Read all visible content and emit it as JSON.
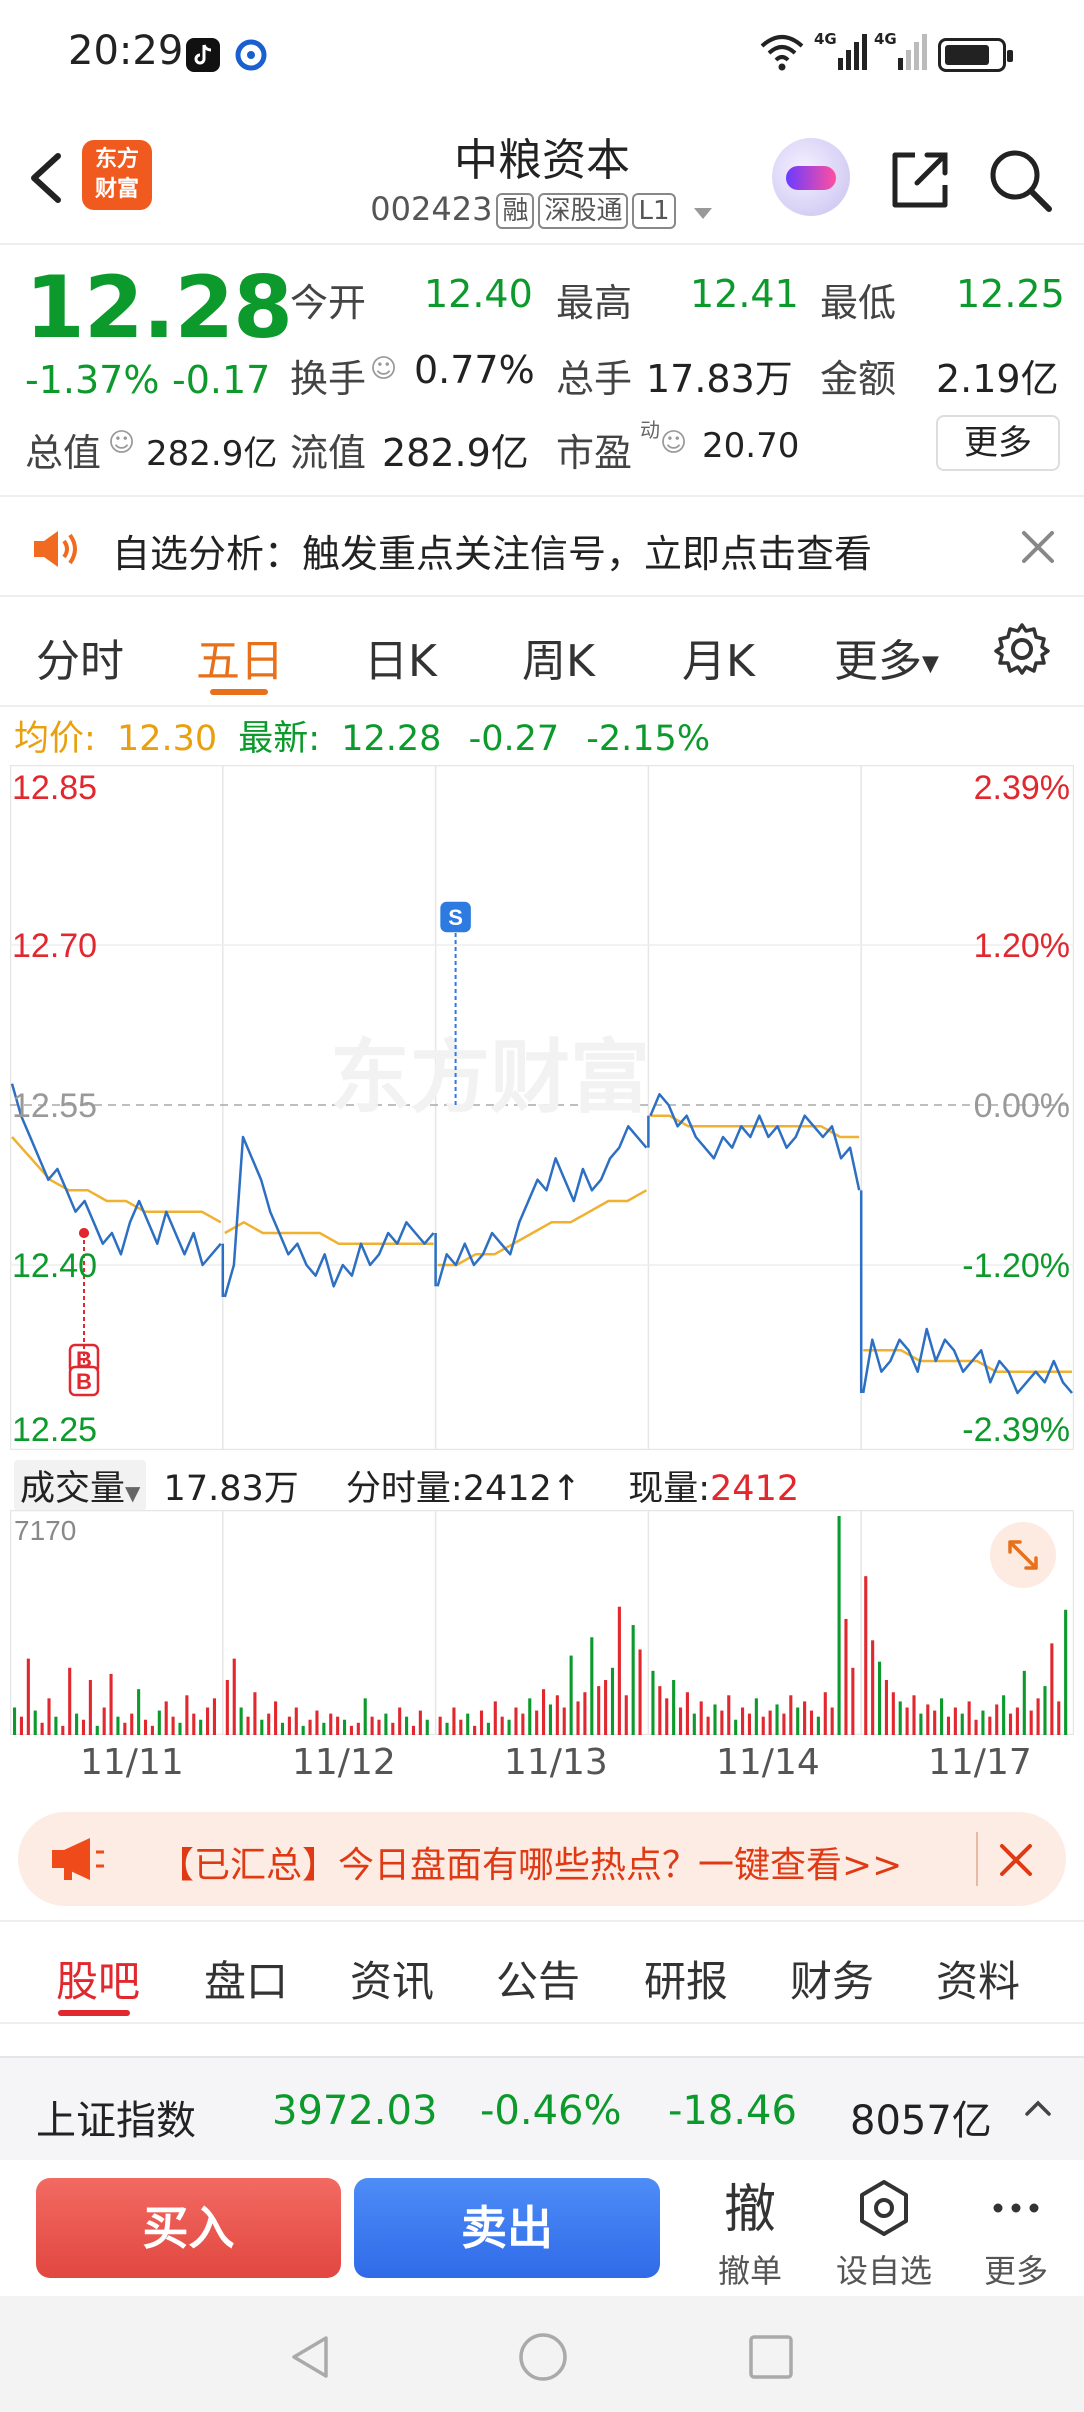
{
  "status_bar": {
    "time": "20:29",
    "network1": "4G",
    "network2": "4G"
  },
  "header": {
    "logo_line1": "东方",
    "logo_line2": "财富",
    "stock_name": "中粮资本",
    "stock_code": "002423",
    "tags": [
      "融",
      "深股通",
      "L1"
    ]
  },
  "quote": {
    "price": "12.28",
    "change_pct": "-1.37%",
    "change_abs": "-0.17",
    "open_label": "今开",
    "open": "12.40",
    "high_label": "最高",
    "high": "12.41",
    "low_label": "最低",
    "low": "12.25",
    "turnover_label": "换手",
    "turnover": "0.77%",
    "volume_label": "总手",
    "volume": "17.83万",
    "amount_label": "金额",
    "amount": "2.19亿",
    "mktcap_label": "总值",
    "mktcap": "282.9亿",
    "float_label": "流值",
    "float_cap": "282.9亿",
    "pe_label": "市盈",
    "pe_sup": "动",
    "pe": "20.70",
    "more": "更多"
  },
  "notice": {
    "text": "自选分析：触发重点关注信号，立即点击查看"
  },
  "tabs": [
    "分时",
    "五日",
    "日K",
    "周K",
    "月K",
    "更多"
  ],
  "chart_header": {
    "avg_label": "均价:",
    "avg": "12.30",
    "latest_label": "最新:",
    "latest": "12.28",
    "chg": "-0.27",
    "chg_pct": "-2.15%"
  },
  "chart_data": {
    "type": "line",
    "y_ticks_left": [
      "12.85",
      "12.70",
      "12.55",
      "12.40",
      "12.25"
    ],
    "y_ticks_right": [
      "2.39%",
      "1.20%",
      "0.00%",
      "-1.20%",
      "-2.39%"
    ],
    "ylim": [
      12.25,
      12.85
    ],
    "reference_price": 12.55,
    "x_labels": [
      "11/11",
      "11/12",
      "11/13",
      "11/14",
      "11/17"
    ],
    "watermark": "东方财富",
    "markers": [
      {
        "day": "11/11",
        "type": "B",
        "price": 12.43
      },
      {
        "day": "11/11",
        "type": "B",
        "price": 12.43
      },
      {
        "day": "11/13",
        "type": "S",
        "price": 12.55
      }
    ],
    "series": [
      {
        "name": "price",
        "days": [
          [
            12.57,
            12.54,
            12.52,
            12.5,
            12.48,
            12.49,
            12.47,
            12.45,
            12.46,
            12.44,
            12.42,
            12.43,
            12.41,
            12.44,
            12.46,
            12.44,
            12.42,
            12.45,
            12.43,
            12.41,
            12.43,
            12.4,
            12.41,
            12.42
          ],
          [
            12.37,
            12.4,
            12.52,
            12.5,
            12.48,
            12.45,
            12.43,
            12.41,
            12.42,
            12.4,
            12.39,
            12.41,
            12.38,
            12.4,
            12.39,
            12.42,
            12.4,
            12.41,
            12.43,
            12.42,
            12.44,
            12.43,
            12.42,
            12.43
          ],
          [
            12.38,
            12.41,
            12.4,
            12.42,
            12.4,
            12.41,
            12.43,
            12.42,
            12.41,
            12.44,
            12.46,
            12.48,
            12.47,
            12.5,
            12.48,
            12.46,
            12.49,
            12.47,
            12.48,
            12.5,
            12.51,
            12.53,
            12.52,
            12.51
          ],
          [
            12.54,
            12.56,
            12.55,
            12.53,
            12.54,
            12.52,
            12.51,
            12.5,
            12.52,
            12.51,
            12.53,
            12.52,
            12.54,
            12.52,
            12.53,
            12.51,
            12.52,
            12.54,
            12.53,
            12.52,
            12.53,
            12.5,
            12.51,
            12.47
          ],
          [
            12.28,
            12.33,
            12.3,
            12.31,
            12.33,
            12.32,
            12.3,
            12.34,
            12.31,
            12.33,
            12.32,
            12.3,
            12.31,
            12.32,
            12.29,
            12.31,
            12.3,
            12.28,
            12.29,
            12.3,
            12.29,
            12.31,
            12.29,
            12.28
          ]
        ]
      },
      {
        "name": "avg",
        "days": [
          [
            12.52,
            12.5,
            12.48,
            12.47,
            12.47,
            12.46,
            12.46,
            12.45,
            12.45,
            12.45,
            12.45,
            12.44
          ],
          [
            12.43,
            12.44,
            12.43,
            12.43,
            12.43,
            12.43,
            12.42,
            12.42,
            12.42,
            12.42,
            12.42,
            12.42
          ],
          [
            12.4,
            12.4,
            12.41,
            12.41,
            12.42,
            12.43,
            12.44,
            12.44,
            12.45,
            12.46,
            12.46,
            12.47
          ],
          [
            12.54,
            12.54,
            12.53,
            12.53,
            12.53,
            12.53,
            12.53,
            12.53,
            12.53,
            12.53,
            12.52,
            12.52
          ],
          [
            12.32,
            12.32,
            12.32,
            12.31,
            12.31,
            12.31,
            12.31,
            12.3,
            12.3,
            12.3,
            12.3,
            12.3
          ]
        ]
      }
    ],
    "volume_header": {
      "label": "成交量",
      "total": "17.83万",
      "tick_label": "分时量:",
      "tick_value": "2412",
      "now_label": "现量:",
      "now_value": "2412"
    },
    "volume_max_label": "7170",
    "volume": [
      [
        900,
        600,
        2500,
        800,
        400,
        1200,
        600,
        300,
        2200,
        700,
        500,
        1800,
        300,
        900,
        2000,
        600,
        400,
        700,
        1500,
        500,
        300,
        800,
        1100,
        600,
        400,
        1300,
        700,
        500,
        900,
        1200
      ],
      [
        1800,
        2500,
        900,
        600,
        1400,
        500,
        700,
        1100,
        400,
        600,
        900,
        300,
        500,
        800,
        400,
        700,
        600,
        500,
        300,
        400,
        1200,
        600,
        500,
        700,
        400,
        900,
        600,
        300,
        800,
        500
      ],
      [
        600,
        400,
        900,
        500,
        700,
        300,
        800,
        400,
        1100,
        600,
        500,
        900,
        700,
        1200,
        800,
        1500,
        1000,
        1300,
        900,
        2600,
        1100,
        1400,
        3200,
        1600,
        1800,
        2200,
        4200,
        1300,
        3600,
        2800
      ],
      [
        2100,
        1600,
        1200,
        1800,
        900,
        1400,
        700,
        1100,
        600,
        1000,
        800,
        1300,
        500,
        900,
        700,
        1200,
        600,
        800,
        1000,
        700,
        1300,
        900,
        1100,
        800,
        600,
        1400,
        900,
        7170,
        3800,
        2200
      ],
      [
        5200,
        3100,
        2400,
        1800,
        1400,
        1100,
        900,
        1300,
        700,
        1000,
        800,
        1200,
        600,
        900,
        700,
        1100,
        500,
        800,
        600,
        1000,
        1300,
        700,
        900,
        2100,
        800,
        1200,
        1600,
        3000,
        1100,
        4100
      ]
    ]
  },
  "banner": {
    "text": "【已汇总】今日盘面有哪些热点？一键查看>>"
  },
  "subtabs": [
    "股吧",
    "盘口",
    "资讯",
    "公告",
    "研报",
    "财务",
    "资料"
  ],
  "index_bar": {
    "name": "上证指数",
    "value": "3972.03",
    "pct": "-0.46%",
    "chg": "-18.46",
    "amount": "8057亿"
  },
  "actions": {
    "buy": "买入",
    "sell": "卖出",
    "cancel_icon": "撤",
    "cancel": "撤单",
    "watch": "设自选",
    "more": "更多"
  },
  "colors": {
    "up": "#e0282e",
    "down": "#0b9a2b",
    "accent": "#e8701a",
    "price_line": "#2d6fc2",
    "avg_line": "#f0b030"
  }
}
